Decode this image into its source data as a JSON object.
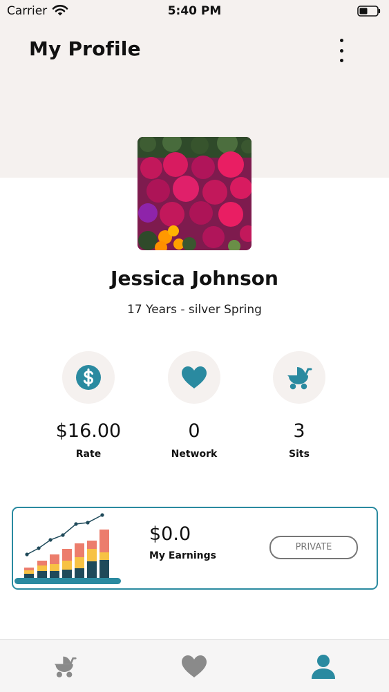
{
  "status_bar": {
    "carrier": "Carrier",
    "time": "5:40 PM"
  },
  "header": {
    "title": "My Profile",
    "menu_icon": "more-vertical-icon"
  },
  "profile": {
    "name": "Jessica Johnson",
    "subtitle": "17 Years - silver Spring"
  },
  "stats": [
    {
      "icon": "dollar-icon",
      "value": "$16.00",
      "label": "Rate"
    },
    {
      "icon": "heart-icon",
      "value": "0",
      "label": "Network"
    },
    {
      "icon": "stroller-icon",
      "value": "3",
      "label": "Sits"
    }
  ],
  "earnings": {
    "amount": "$0.0",
    "label": "My Earnings",
    "button": "PRIVATE"
  },
  "tabs": [
    {
      "icon": "stroller-icon",
      "active": false
    },
    {
      "icon": "heart-icon",
      "active": false
    },
    {
      "icon": "profile-icon",
      "active": true
    }
  ],
  "colors": {
    "accent": "#2a8aa0",
    "icon_gray": "#8a8a8a",
    "header_bg": "#f5f1ef"
  }
}
